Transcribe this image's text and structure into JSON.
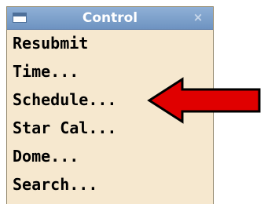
{
  "window": {
    "title": "Control",
    "menu_icon": "window-menu-icon",
    "close_icon": "close-icon",
    "close_glyph": "×"
  },
  "menu": {
    "items": [
      {
        "label": "Resubmit"
      },
      {
        "label": "Time..."
      },
      {
        "label": "Schedule..."
      },
      {
        "label": "Star Cal..."
      },
      {
        "label": "Dome..."
      },
      {
        "label": "Search..."
      }
    ]
  },
  "annotation": {
    "type": "arrow",
    "points_to": "Schedule...",
    "color": "#e00000",
    "outline": "#000000"
  }
}
